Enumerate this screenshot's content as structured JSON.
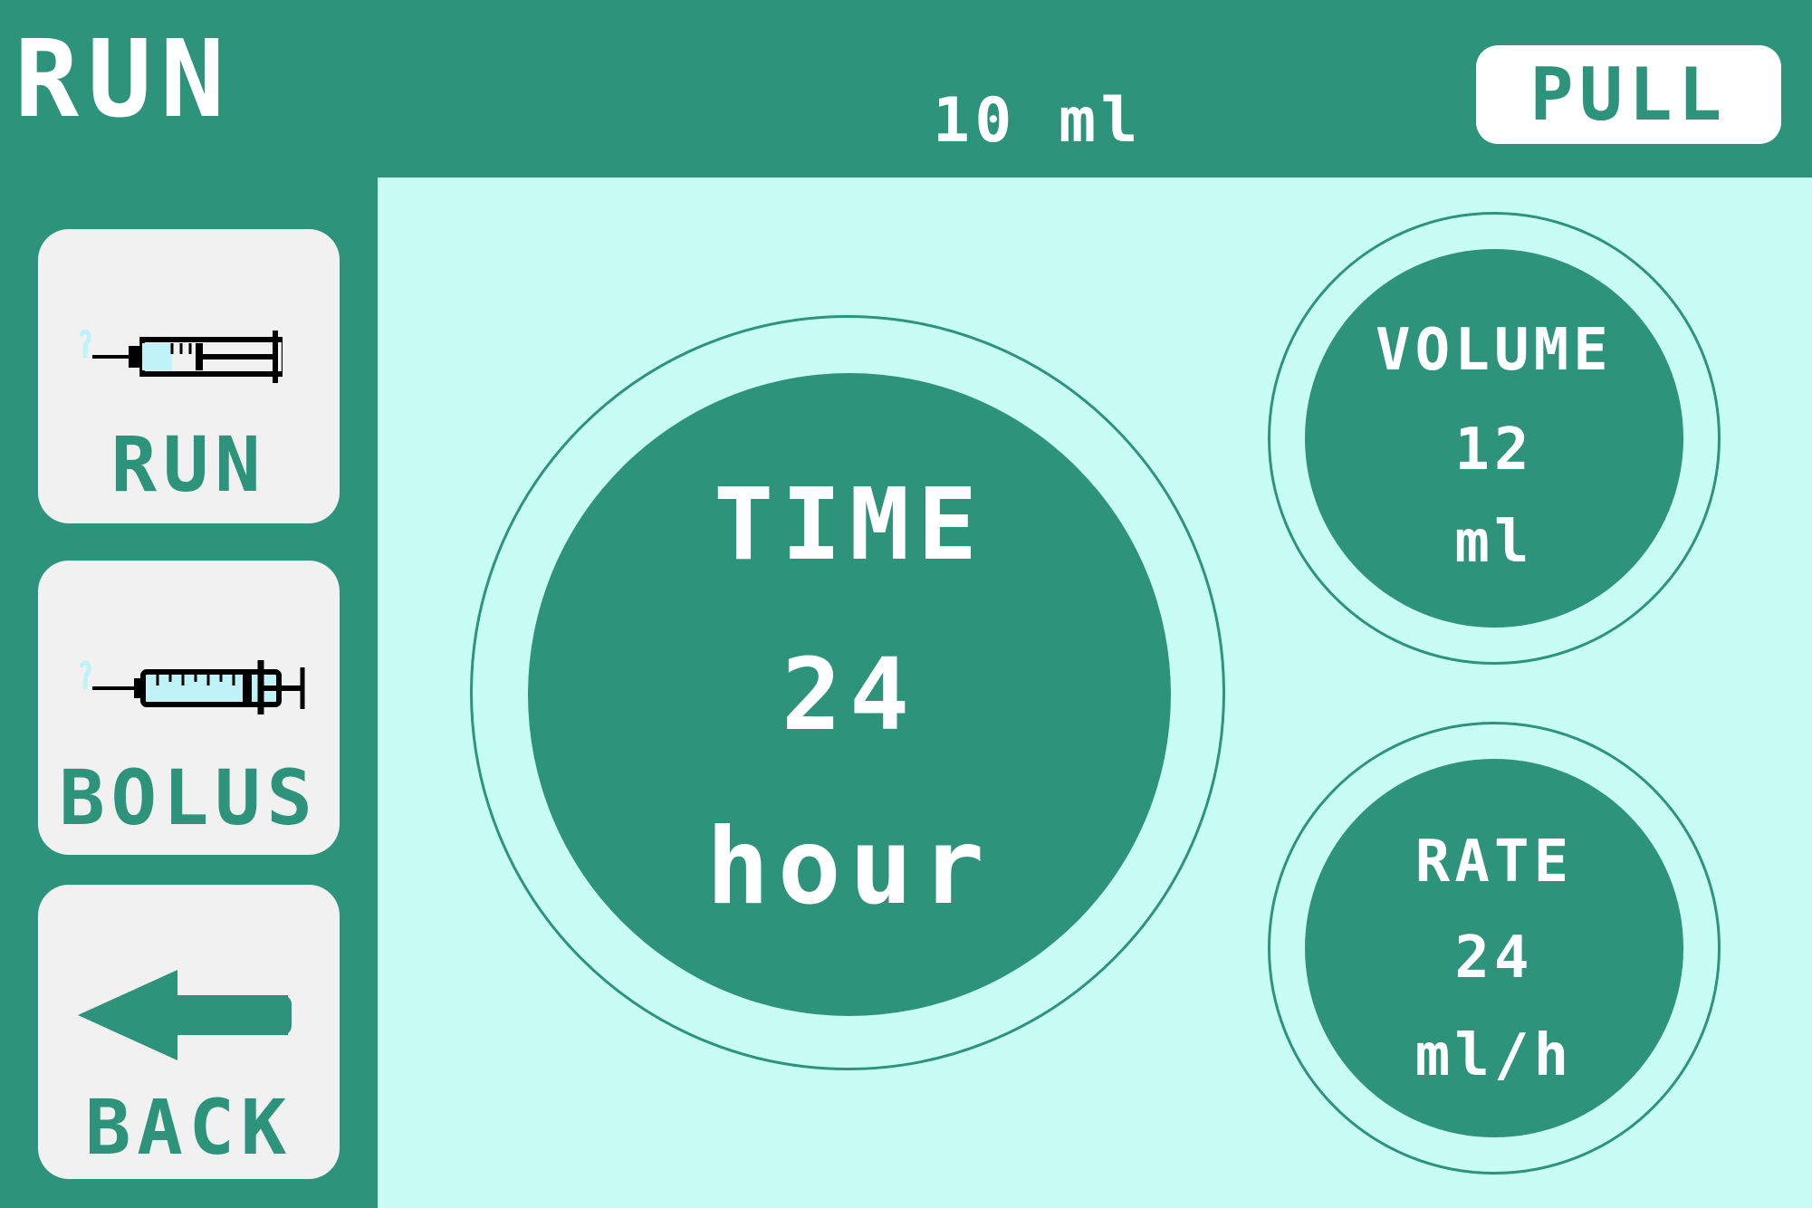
{
  "header": {
    "title": "RUN",
    "syringe_size": "10 ml",
    "pull_label": "PULL"
  },
  "sidebar": {
    "items": [
      {
        "label": "RUN",
        "icon": "syringe-run-icon"
      },
      {
        "label": "BOLUS",
        "icon": "syringe-bolus-icon"
      },
      {
        "label": "BACK",
        "icon": "back-arrow-icon"
      }
    ]
  },
  "time": {
    "label": "TIME",
    "value": "24",
    "unit": "hour"
  },
  "volume": {
    "label": "VOLUME",
    "value": "12",
    "unit": "ml"
  },
  "rate": {
    "label": "RATE",
    "value": "24",
    "unit": "ml/h"
  },
  "colors": {
    "primary": "#2e937b",
    "background": "#c8fdf6",
    "button": "#f1f1f1",
    "syringe_fluid": "#bff3f7"
  }
}
